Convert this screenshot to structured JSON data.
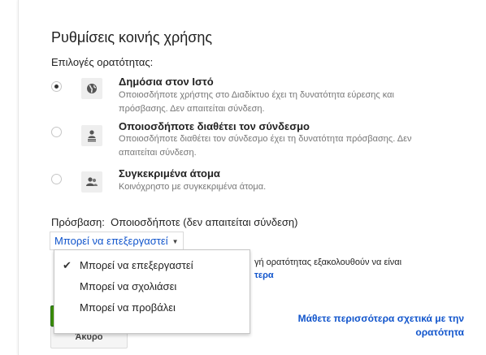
{
  "dialog": {
    "title": "Ρυθμίσεις κοινής χρήσης",
    "visibility_label": "Επιλογές ορατότητας:",
    "options": [
      {
        "title": "Δημόσια στον Ιστό",
        "description": "Οποιοσδήποτε χρήστης στο Διαδίκτυο έχει τη δυνατότητα εύρεσης και πρόσβασης. Δεν απαιτείται σύνδεση.",
        "icon": "globe-icon",
        "selected": true
      },
      {
        "title": "Οποιοσδήποτε διαθέτει τον σύνδεσμο",
        "description": "Οποιοσδήποτε διαθέτει τον σύνδεσμο έχει τη δυνατότητα πρόσβασης. Δεν απαιτείται σύνδεση.",
        "icon": "person-link-icon",
        "selected": false
      },
      {
        "title": "Συγκεκριμένα άτομα",
        "description": "Κοινόχρηστο με συγκεκριμένα άτομα.",
        "icon": "people-icon",
        "selected": false
      }
    ],
    "access": {
      "label": "Πρόσβαση:",
      "value": "Οποιοσδήποτε (δεν απαιτείται σύνδεση)",
      "select_label": "Μπορεί να επεξεργαστεί"
    },
    "menu": {
      "items": [
        {
          "label": "Μπορεί να επεξεργαστεί",
          "checked": true
        },
        {
          "label": "Μπορεί να σχολιάσει",
          "checked": false
        },
        {
          "label": "Μπορεί να προβάλει",
          "checked": false
        }
      ]
    },
    "behind_text": {
      "line1": "γή ορατότητας εξακολουθούν να είναι",
      "link_fragment": "τερα"
    },
    "buttons": {
      "cancel": "Άκυρο"
    },
    "learn_more": "Μάθετε περισσότερα σχετικά με την ορατότητα",
    "colors": {
      "link": "#1155cc",
      "save_green": "#3d9400"
    }
  }
}
